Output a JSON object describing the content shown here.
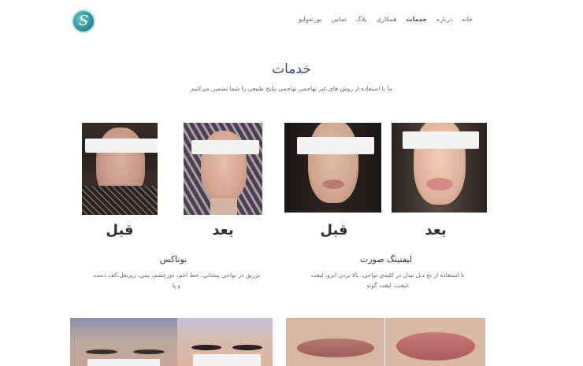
{
  "header": {
    "logo_letter": "S",
    "nav": [
      "خانه",
      "درباره",
      "خدمات",
      "همکاری",
      "بلاگ",
      "تماس",
      "پورتفولیو"
    ],
    "active_index": 2
  },
  "section": {
    "title": "خدمات",
    "subtitle": "ما با استفاده از روش های غیر تهاجمی تهاجمی نتایج طبیعی را شما تضمین می‌کنیم"
  },
  "services": [
    {
      "title": "لیفتینگ صورت",
      "desc_line1": "با استفاده از نخ دبل نیدل در کلیه‌ی نواحی، بالا بردن ابرو، لیفت",
      "desc_line2": "غبغب، لیفت گونه",
      "captions": [
        "بعد",
        "قبل"
      ]
    },
    {
      "title": "بوتاکس",
      "desc_line1": "تزریق در نواحی پیشانی، خط اخم، دورچشم، بینی، زیربغل،کف دست",
      "desc_line2": "و پا",
      "captions": [
        "بعد",
        "قبل"
      ]
    }
  ],
  "colors": {
    "title": "#3d4c6b",
    "logo": "#2c8c96"
  }
}
